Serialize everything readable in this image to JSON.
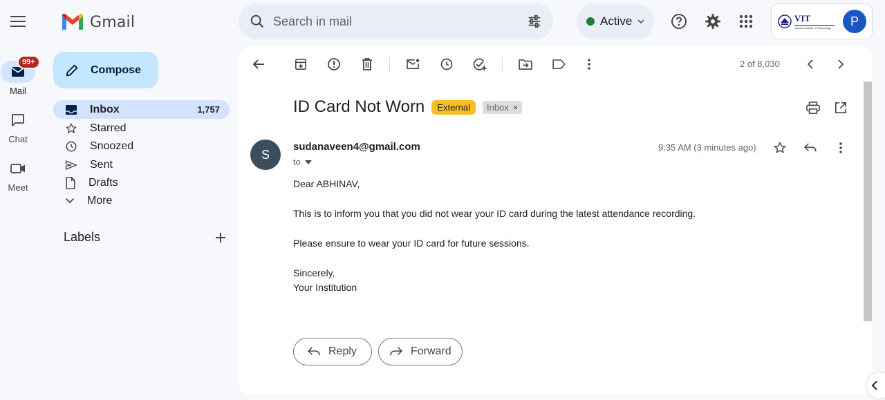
{
  "header": {
    "app_name": "Gmail",
    "search_placeholder": "Search in mail",
    "status_label": "Active",
    "account_org": "VIT",
    "account_org_sub": "Vellore Institute of Technology",
    "avatar_letter": "P"
  },
  "rail": {
    "mail_label": "Mail",
    "mail_badge": "99+",
    "chat_label": "Chat",
    "meet_label": "Meet"
  },
  "sidebar": {
    "compose_label": "Compose",
    "items": [
      {
        "label": "Inbox",
        "count": "1,757",
        "icon": "inbox-icon"
      },
      {
        "label": "Starred",
        "icon": "star-icon"
      },
      {
        "label": "Snoozed",
        "icon": "clock-icon"
      },
      {
        "label": "Sent",
        "icon": "send-icon"
      },
      {
        "label": "Drafts",
        "icon": "draft-icon"
      },
      {
        "label": "More",
        "icon": "chevron-down-icon"
      }
    ],
    "labels_heading": "Labels"
  },
  "message": {
    "pager": "2 of 8,030",
    "subject": "ID Card Not Worn",
    "tag_external": "External",
    "tag_inbox": "Inbox",
    "tag_inbox_close": "×",
    "sender_initial": "S",
    "sender": "sudanaveen4@gmail.com",
    "to_label": "to",
    "time": "9:35 AM (3 minutes ago)",
    "body": {
      "greeting": "Dear ABHINAV,",
      "line1": "This is to inform you that you did not wear your ID card during the latest attendance recording.",
      "line2": "Please ensure to wear your ID card for future sessions.",
      "closing": "Sincerely,",
      "signature": "Your Institution"
    },
    "reply_label": "Reply",
    "forward_label": "Forward"
  },
  "colors": {
    "accent": "#c2e7ff",
    "selected": "#d3e3fd",
    "status_dot": "#188038",
    "external_tag": "#f6bf26",
    "badge": "#b3261e",
    "avatar": "#1a56c4"
  }
}
